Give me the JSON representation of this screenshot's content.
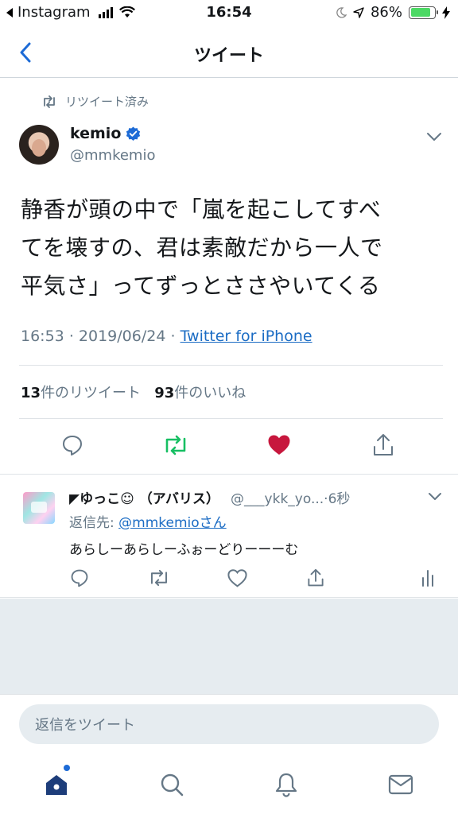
{
  "status_bar": {
    "back_app": "Instagram",
    "time": "16:54",
    "battery": "86%",
    "battery_level": 0.86
  },
  "nav": {
    "title": "ツイート"
  },
  "tweet": {
    "retweeted_label": "リツイート済み",
    "author_name": "kemio",
    "author_handle": "@mmkemio",
    "lines": [
      "静香が頭の中で「嵐を起こしてすべ",
      "てを壊すの、君は素敵だから一人で",
      "平気さ」ってずっとささやいてくる"
    ],
    "time": "16:53",
    "separator": "·",
    "date": "2019/06/24",
    "source": "Twitter for iPhone",
    "retweet_count": "13",
    "retweet_suffix": "件のリツイート",
    "like_count": "93",
    "like_suffix": "件のいいね"
  },
  "reply": {
    "name": "◤ゆっこ☺︎ （アバリス）",
    "handle": "@___ykk_yo...",
    "time": "·6秒",
    "reply_to_label": "返信先:",
    "reply_to_handle": "@mmkemioさん",
    "text": "あらしーあらしーふぉーどりーーーむ"
  },
  "compose": {
    "placeholder": "返信をツイート"
  },
  "colors": {
    "accent": "#1da1f2",
    "retweet_green": "#17bf63",
    "like_red": "#c7173d",
    "link_blue": "#1b6cc4",
    "tab_active": "#1d3d7a"
  }
}
